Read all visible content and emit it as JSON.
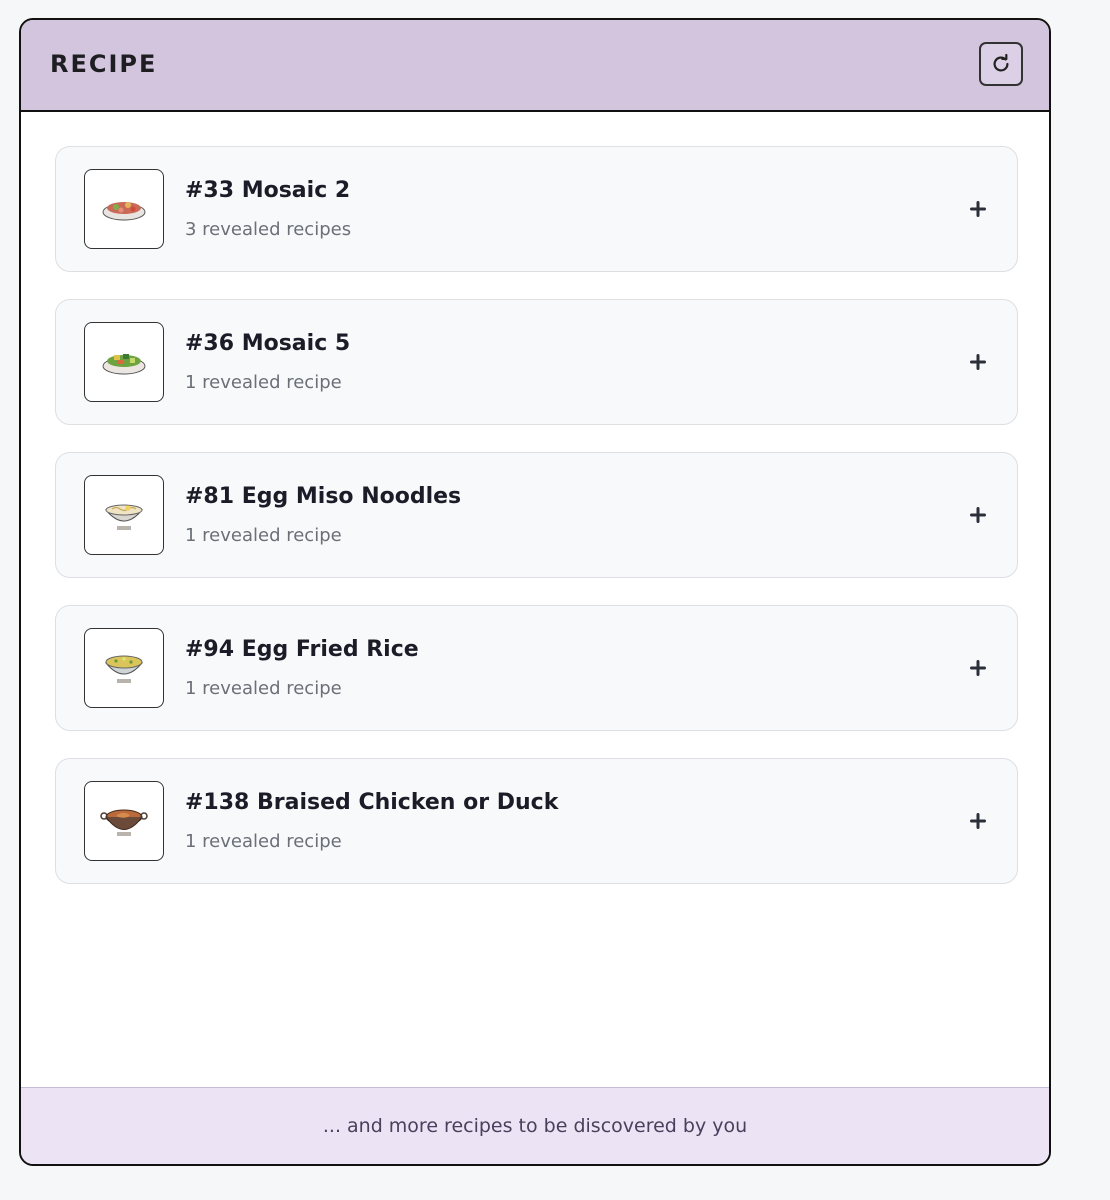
{
  "header": {
    "title": "RECIPE",
    "refresh_icon": "refresh-icon"
  },
  "recipes": [
    {
      "title": "#33 Mosaic 2",
      "subtitle": "3 revealed recipes",
      "icon": "mosaic-salad-dish-icon",
      "accent": "#c96a56"
    },
    {
      "title": "#36 Mosaic 5",
      "subtitle": "1 revealed recipe",
      "icon": "mosaic-greens-dish-icon",
      "accent": "#6ea43f"
    },
    {
      "title": "#81 Egg Miso Noodles",
      "subtitle": "1 revealed recipe",
      "icon": "noodle-bowl-icon",
      "accent": "#e8d7a6"
    },
    {
      "title": "#94 Egg Fried Rice",
      "subtitle": "1 revealed recipe",
      "icon": "fried-rice-bowl-icon",
      "accent": "#d9c55a"
    },
    {
      "title": "#138 Braised Chicken or Duck",
      "subtitle": "1 revealed recipe",
      "icon": "braised-meat-pot-icon",
      "accent": "#b86a3b"
    }
  ],
  "expand_icon": "plus-icon",
  "footer": {
    "text": "... and more recipes to be discovered by you"
  },
  "colors": {
    "header_bg": "#d3c5de",
    "footer_bg": "#ece4f4",
    "card_bg": "#f8f9fa"
  }
}
